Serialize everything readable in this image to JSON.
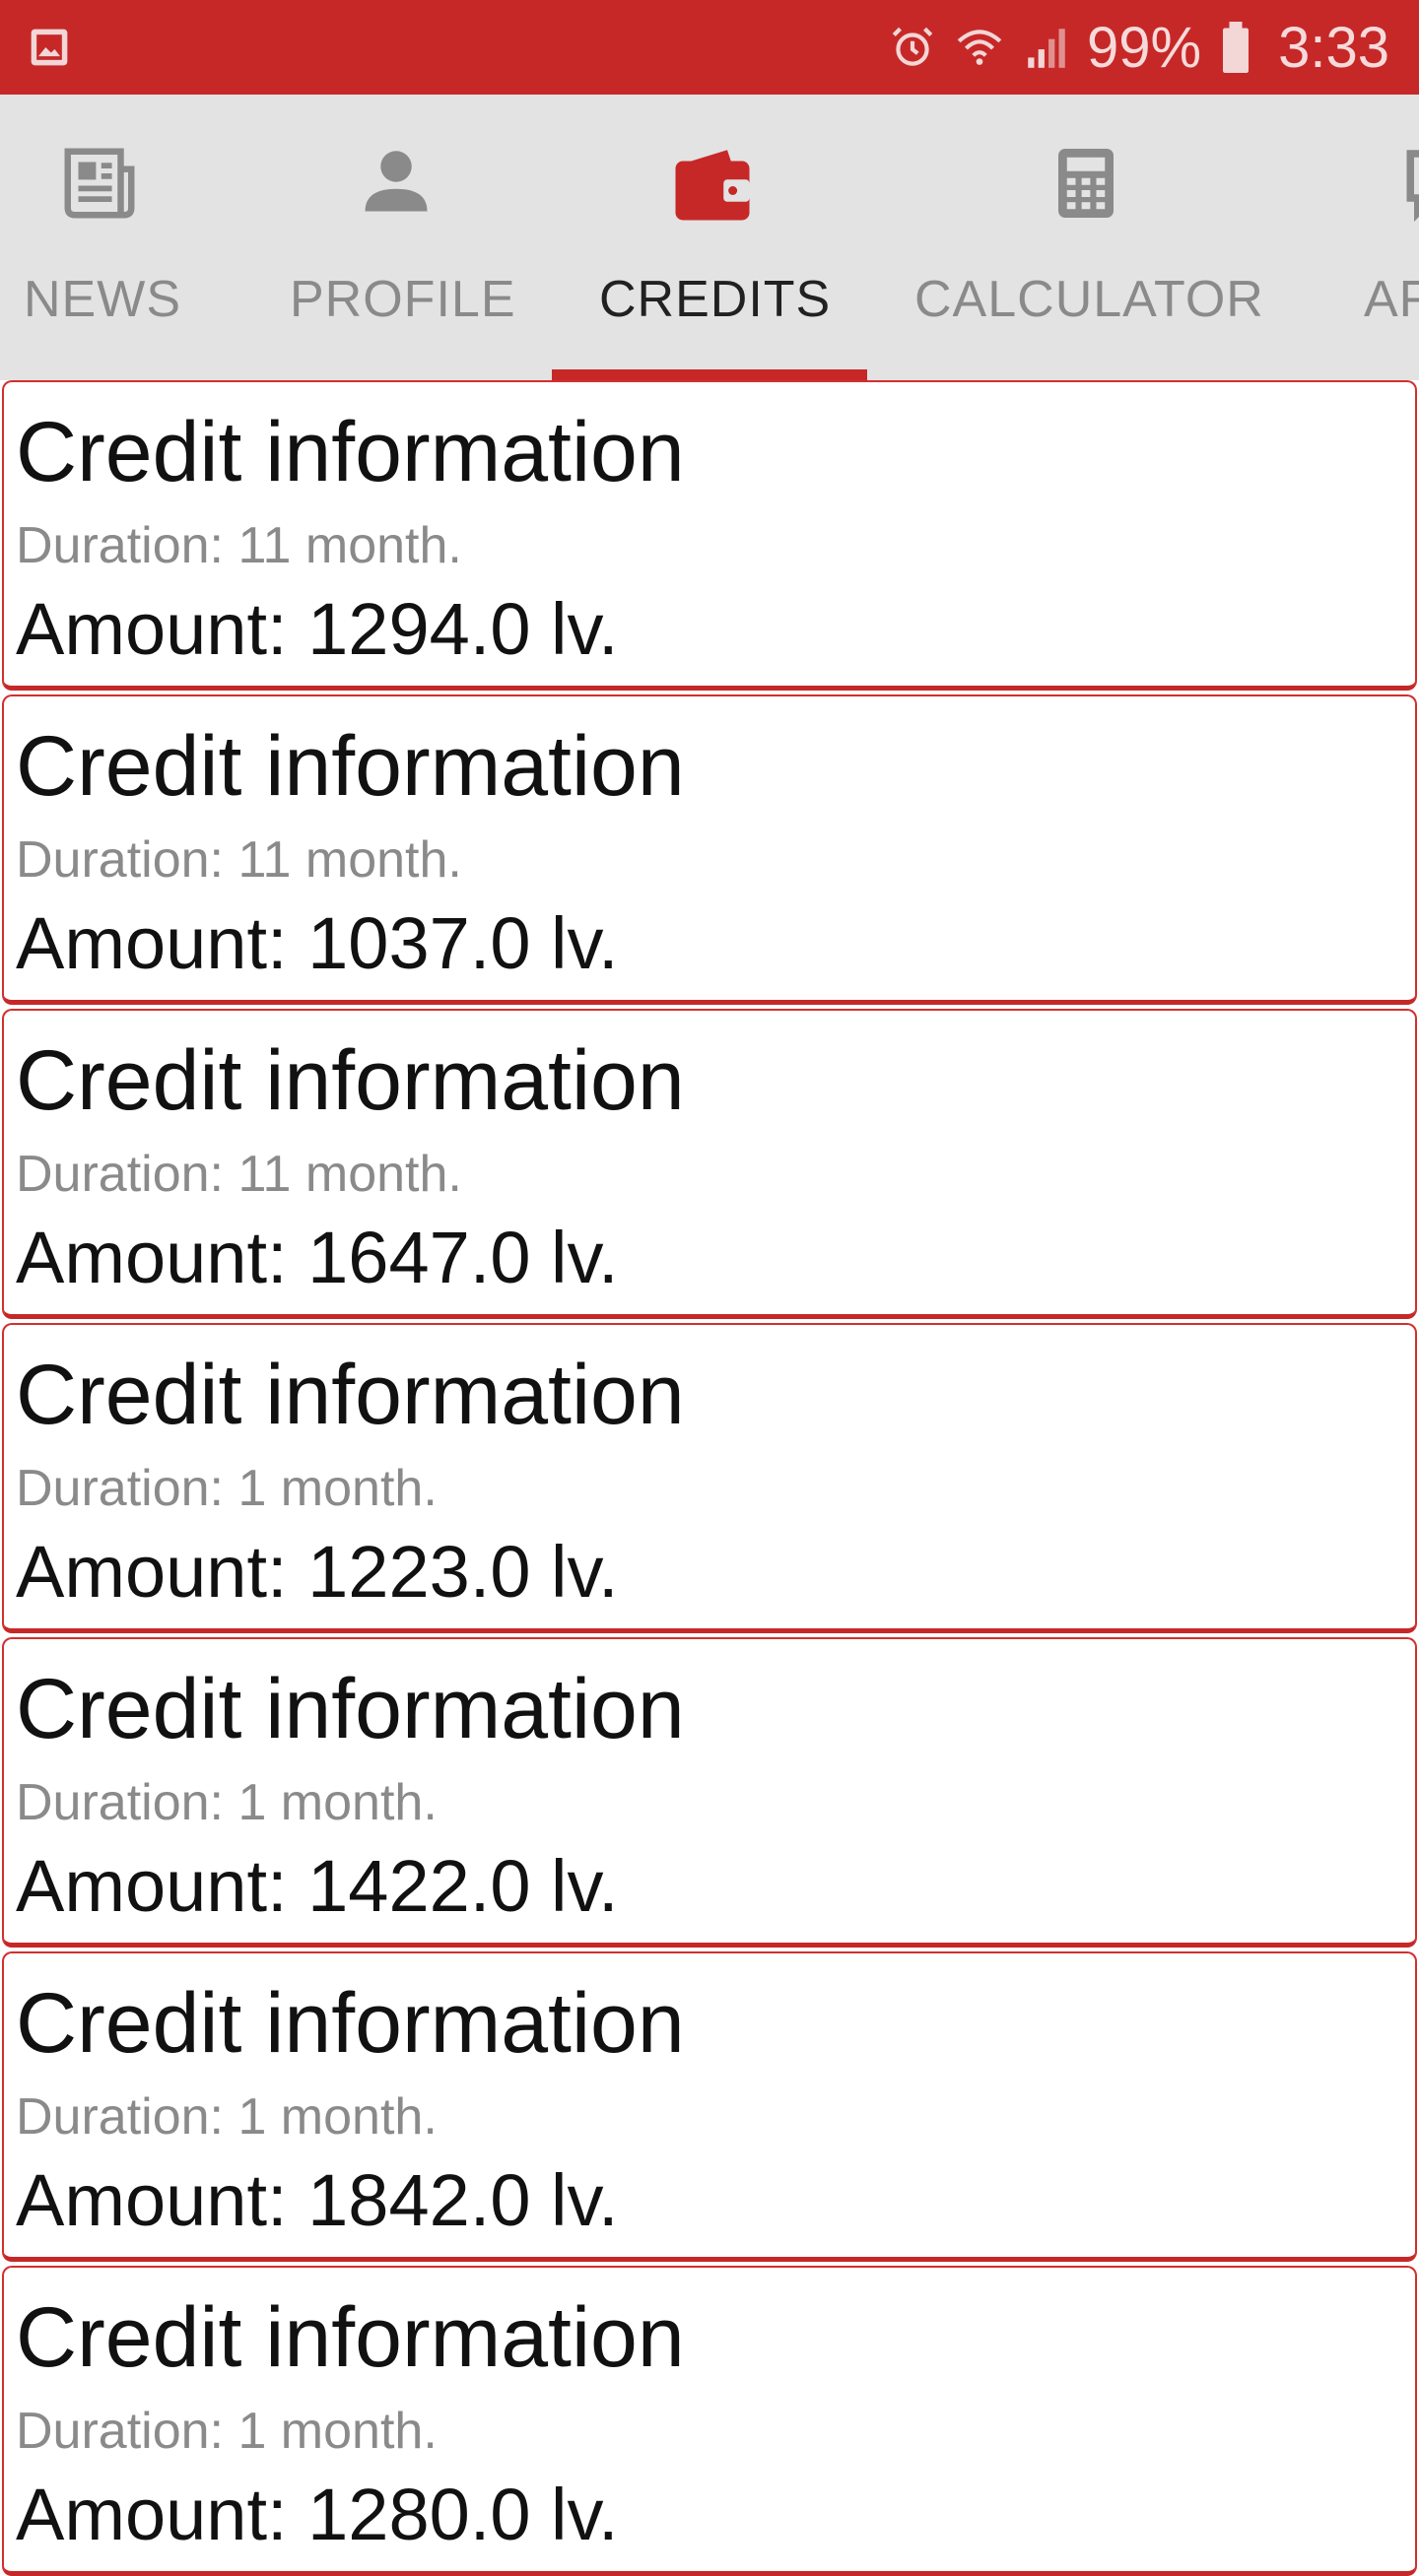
{
  "status_bar": {
    "battery": "99%",
    "time": "3:33",
    "icons": [
      "gallery-icon",
      "alarm-icon",
      "wifi-icon",
      "signal-icon",
      "battery-icon"
    ]
  },
  "tabs": [
    {
      "label": "NEWS",
      "icon": "newspaper-icon",
      "active": false
    },
    {
      "label": "PROFILE",
      "icon": "person-icon",
      "active": false
    },
    {
      "label": "CREDITS",
      "icon": "wallet-icon",
      "active": true
    },
    {
      "label": "CALCULATOR",
      "icon": "calculator-icon",
      "active": false
    },
    {
      "label": "AF",
      "icon": "chat-icon",
      "active": false
    }
  ],
  "credits": [
    {
      "title": "Credit information",
      "duration": "Duration: 11 month.",
      "amount": "Amount: 1294.0 lv."
    },
    {
      "title": "Credit information",
      "duration": "Duration: 11 month.",
      "amount": "Amount: 1037.0 lv."
    },
    {
      "title": "Credit information",
      "duration": "Duration: 11 month.",
      "amount": "Amount: 1647.0 lv."
    },
    {
      "title": "Credit information",
      "duration": "Duration: 1 month.",
      "amount": "Amount: 1223.0 lv."
    },
    {
      "title": "Credit information",
      "duration": "Duration: 1 month.",
      "amount": "Amount: 1422.0 lv."
    },
    {
      "title": "Credit information",
      "duration": "Duration: 1 month.",
      "amount": "Amount: 1842.0 lv."
    },
    {
      "title": "Credit information",
      "duration": "Duration: 1 month.",
      "amount": "Amount: 1280.0 lv."
    }
  ],
  "colors": {
    "primary": "#c62828",
    "tab_background": "#e3e3e3",
    "inactive": "#8a8a8a"
  }
}
